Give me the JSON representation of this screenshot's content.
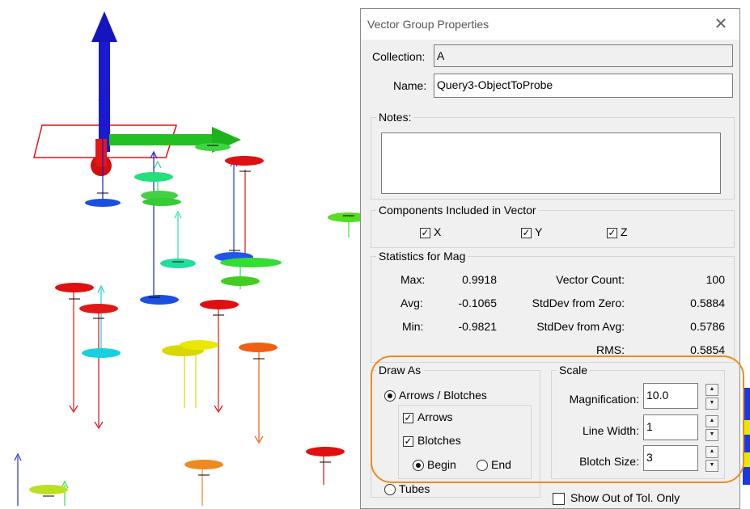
{
  "dialog": {
    "title": "Vector Group Properties",
    "close_icon": "close-icon",
    "collection_label": "Collection:",
    "collection_value": "A",
    "name_label": "Name:",
    "name_value": "Query3-ObjectToProbe",
    "notes_label": "Notes:",
    "notes_value": ""
  },
  "components": {
    "title": "Components Included in Vector",
    "x": {
      "label": "X",
      "checked": true
    },
    "y": {
      "label": "Y",
      "checked": true
    },
    "z": {
      "label": "Z",
      "checked": true
    }
  },
  "statistics": {
    "title": "Statistics for Mag",
    "max_label": "Max:",
    "max": "0.9918",
    "avg_label": "Avg:",
    "avg": "-0.1065",
    "min_label": "Min:",
    "min": "-0.9821",
    "vector_count_label": "Vector Count:",
    "vector_count": "100",
    "stddev_zero_label": "StdDev from Zero:",
    "stddev_zero": "0.5884",
    "stddev_avg_label": "StdDev from  Avg:",
    "stddev_avg": "0.5786",
    "rms_label": "RMS:",
    "rms": "0.5854"
  },
  "draw_as": {
    "title": "Draw As",
    "arrows_blotches": "Arrows / Blotches",
    "arrows": "Arrows",
    "blotches": "Blotches",
    "begin": "Begin",
    "end": "End",
    "tubes": "Tubes"
  },
  "scale": {
    "title": "Scale",
    "magnification_label": "Magnification:",
    "magnification": "10.0",
    "line_width_label": "Line Width:",
    "line_width": "1",
    "blotch_size_label": "Blotch Size:",
    "blotch_size": "3"
  },
  "show_out_of_tol": "Show Out of Tol. Only",
  "colors": {
    "highlight": "#ef8a22",
    "axis_blue": "#1010c8",
    "axis_green": "#22bb22",
    "axis_red": "#dd1111"
  }
}
